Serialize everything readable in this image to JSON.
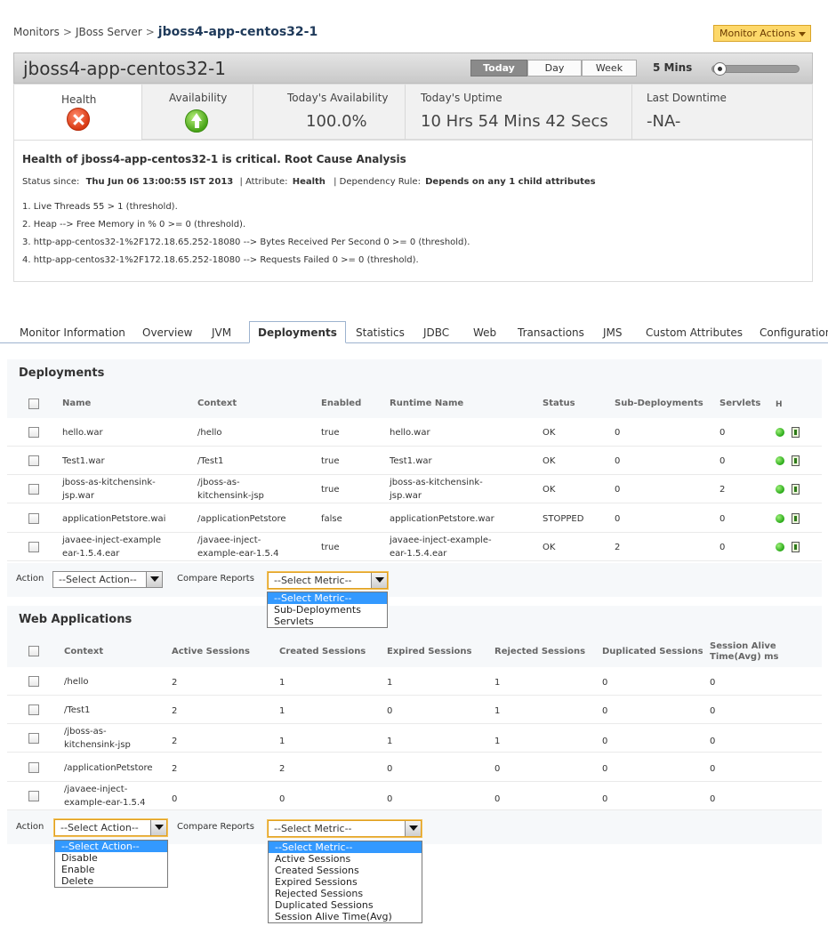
{
  "breadcrumb": {
    "root": "Monitors",
    "parent": "JBoss Server",
    "current": "jboss4-app-centos32-1",
    "sep": ">"
  },
  "monitor_actions": "Monitor Actions",
  "header": {
    "title": "jboss4-app-centos32-1",
    "ranges": [
      "Today",
      "Day",
      "Week"
    ],
    "active_range": "Today",
    "interval": "5 Mins"
  },
  "summary": {
    "health_label": "Health",
    "health_status": "critical",
    "availability_label": "Availability",
    "today_availability_label": "Today's Availability",
    "today_availability_value": "100.0%",
    "today_uptime_label": "Today's Uptime",
    "today_uptime_value": "10 Hrs 54 Mins 42 Secs",
    "last_downtime_label": "Last Downtime",
    "last_downtime_value": "-NA-"
  },
  "rca": {
    "title": "Health of jboss4-app-centos32-1 is critical. Root Cause Analysis",
    "status_since_label": "Status since:",
    "status_since_value": "Thu Jun 06 13:00:55 IST 2013",
    "attribute_label": "| Attribute:",
    "attribute_value": "Health",
    "dependency_label": "| Dependency Rule:",
    "dependency_value": "Depends on any 1 child attributes",
    "lines": [
      "1. Live Threads 55 > 1 (threshold).",
      "2. Heap --> Free Memory in % 0 >= 0 (threshold).",
      "3. http-app-centos32-1%2F172.18.65.252-18080 --> Bytes Received Per Second 0 >= 0 (threshold).",
      "4. http-app-centos32-1%2F172.18.65.252-18080 --> Requests Failed 0 >= 0 (threshold)."
    ]
  },
  "tabs": [
    "Monitor Information",
    "Overview",
    "JVM",
    "Deployments",
    "Statistics",
    "JDBC",
    "Web",
    "Transactions",
    "JMS",
    "Custom Attributes",
    "Configuration"
  ],
  "active_tab": "Deployments",
  "deployments": {
    "heading": "Deployments",
    "columns": [
      "Name",
      "Context",
      "Enabled",
      "Runtime Name",
      "Status",
      "Sub-Deployments",
      "Servlets",
      "H"
    ],
    "rows": [
      {
        "name": [
          "hello.war"
        ],
        "context": [
          "/hello"
        ],
        "enabled": "true",
        "runtime": [
          "hello.war"
        ],
        "status": "OK",
        "sub": "0",
        "servlets": "0"
      },
      {
        "name": [
          "Test1.war"
        ],
        "context": [
          "/Test1"
        ],
        "enabled": "true",
        "runtime": [
          "Test1.war"
        ],
        "status": "OK",
        "sub": "0",
        "servlets": "0"
      },
      {
        "name": [
          "jboss-as-kitchensink-",
          "jsp.war"
        ],
        "context": [
          "/jboss-as-",
          "kitchensink-jsp"
        ],
        "enabled": "true",
        "runtime": [
          "jboss-as-kitchensink-",
          "jsp.war"
        ],
        "status": "OK",
        "sub": "0",
        "servlets": "2"
      },
      {
        "name": [
          "applicationPetstore.wai"
        ],
        "context": [
          "/applicationPetstore"
        ],
        "enabled": "false",
        "runtime": [
          "applicationPetstore.war"
        ],
        "status": "STOPPED",
        "sub": "0",
        "servlets": "0"
      },
      {
        "name": [
          "javaee-inject-example",
          "ear-1.5.4.ear"
        ],
        "context": [
          "/javaee-inject-",
          "example-ear-1.5.4"
        ],
        "enabled": "true",
        "runtime": [
          "javaee-inject-example-",
          "ear-1.5.4.ear"
        ],
        "status": "OK",
        "sub": "2",
        "servlets": "0"
      }
    ],
    "action_label": "Action",
    "action_select": "--Select Action--",
    "compare_label": "Compare Reports",
    "metric_select": "--Select Metric--",
    "metric_options": [
      "--Select Metric--",
      "Sub-Deployments",
      "Servlets"
    ]
  },
  "webapps": {
    "heading": "Web Applications",
    "columns": [
      "Context",
      "Active Sessions",
      "Created Sessions",
      "Expired Sessions",
      "Rejected Sessions",
      "Duplicated Sessions"
    ],
    "last_column": [
      "Session Alive",
      "Time(Avg)  ms"
    ],
    "rows": [
      {
        "context": [
          "/hello"
        ],
        "active": "2",
        "created": "1",
        "expired": "1",
        "rejected": "1",
        "duplicated": "0",
        "alive": "0"
      },
      {
        "context": [
          "/Test1"
        ],
        "active": "2",
        "created": "1",
        "expired": "0",
        "rejected": "1",
        "duplicated": "0",
        "alive": "0"
      },
      {
        "context": [
          "/jboss-as-",
          "kitchensink-jsp"
        ],
        "active": "2",
        "created": "1",
        "expired": "1",
        "rejected": "1",
        "duplicated": "0",
        "alive": "0"
      },
      {
        "context": [
          "/applicationPetstore"
        ],
        "active": "2",
        "created": "2",
        "expired": "0",
        "rejected": "0",
        "duplicated": "0",
        "alive": "0"
      },
      {
        "context": [
          "/javaee-inject-",
          "example-ear-1.5.4"
        ],
        "active": "0",
        "created": "0",
        "expired": "0",
        "rejected": "0",
        "duplicated": "0",
        "alive": "0"
      }
    ],
    "action_label": "Action",
    "action_select": "--Select Action--",
    "action_options": [
      "--Select Action--",
      "Disable",
      "Enable",
      "Delete"
    ],
    "compare_label": "Compare Reports",
    "metric_select": "--Select Metric--",
    "metric_options": [
      "--Select Metric--",
      "Active Sessions",
      "Created Sessions",
      "Expired Sessions",
      "Rejected Sessions",
      "Duplicated Sessions",
      "Session Alive Time(Avg)"
    ]
  }
}
